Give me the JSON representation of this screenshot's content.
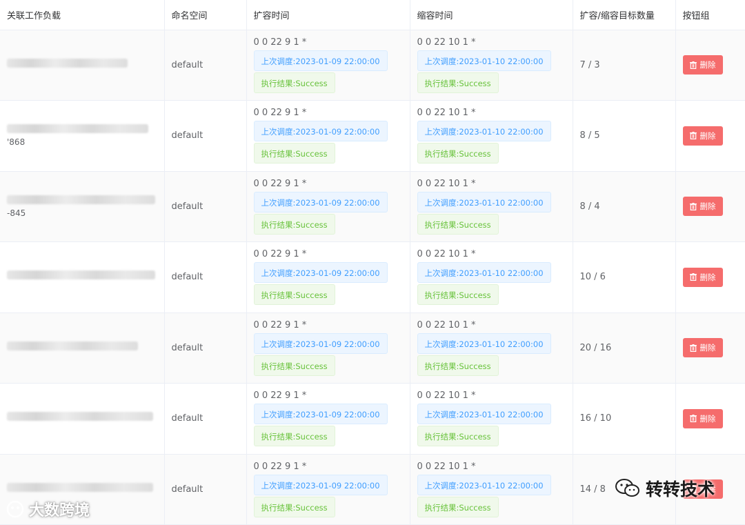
{
  "table": {
    "headers": {
      "workload": "关联工作负载",
      "namespace": "命名空间",
      "scale_out_time": "扩容时间",
      "scale_in_time": "缩容时间",
      "target_count": "扩容/缩容目标数量",
      "buttons": "按钮组"
    },
    "rows": [
      {
        "workload_suffix": "",
        "namespace": "default",
        "scale_out_cron": "0 0 22 9 1 *",
        "scale_out_last": "上次调度:2023-01-09 22:00:00",
        "scale_out_result": "执行结果:Success",
        "scale_in_cron": "0 0 22 10 1 *",
        "scale_in_last": "上次调度:2023-01-10 22:00:00",
        "scale_in_result": "执行结果:Success",
        "target": "7 / 3",
        "delete_label": "删除"
      },
      {
        "workload_suffix": "'868",
        "namespace": "default",
        "scale_out_cron": "0 0 22 9 1 *",
        "scale_out_last": "上次调度:2023-01-09 22:00:00",
        "scale_out_result": "执行结果:Success",
        "scale_in_cron": "0 0 22 10 1 *",
        "scale_in_last": "上次调度:2023-01-10 22:00:00",
        "scale_in_result": "执行结果:Success",
        "target": "8 / 5",
        "delete_label": "删除"
      },
      {
        "workload_suffix": "-845",
        "namespace": "default",
        "scale_out_cron": "0 0 22 9 1 *",
        "scale_out_last": "上次调度:2023-01-09 22:00:00",
        "scale_out_result": "执行结果:Success",
        "scale_in_cron": "0 0 22 10 1 *",
        "scale_in_last": "上次调度:2023-01-10 22:00:00",
        "scale_in_result": "执行结果:Success",
        "target": "8 / 4",
        "delete_label": "删除"
      },
      {
        "workload_suffix": "",
        "namespace": "default",
        "scale_out_cron": "0 0 22 9 1 *",
        "scale_out_last": "上次调度:2023-01-09 22:00:00",
        "scale_out_result": "执行结果:Success",
        "scale_in_cron": "0 0 22 10 1 *",
        "scale_in_last": "上次调度:2023-01-10 22:00:00",
        "scale_in_result": "执行结果:Success",
        "target": "10 / 6",
        "delete_label": "删除"
      },
      {
        "workload_suffix": "",
        "namespace": "default",
        "scale_out_cron": "0 0 22 9 1 *",
        "scale_out_last": "上次调度:2023-01-09 22:00:00",
        "scale_out_result": "执行结果:Success",
        "scale_in_cron": "0 0 22 10 1 *",
        "scale_in_last": "上次调度:2023-01-10 22:00:00",
        "scale_in_result": "执行结果:Success",
        "target": "20 / 16",
        "delete_label": "删除"
      },
      {
        "workload_suffix": "",
        "namespace": "default",
        "scale_out_cron": "0 0 22 9 1 *",
        "scale_out_last": "上次调度:2023-01-09 22:00:00",
        "scale_out_result": "执行结果:Success",
        "scale_in_cron": "0 0 22 10 1 *",
        "scale_in_last": "上次调度:2023-01-10 22:00:00",
        "scale_in_result": "执行结果:Success",
        "target": "16 / 10",
        "delete_label": "删除"
      },
      {
        "workload_suffix": "",
        "namespace": "default",
        "scale_out_cron": "0 0 22 9 1 *",
        "scale_out_last": "上次调度:2023-01-09 22:00:00",
        "scale_out_result": "执行结果:Success",
        "scale_in_cron": "0 0 22 10 1 *",
        "scale_in_last": "上次调度:2023-01-10 22:00:00",
        "scale_in_result": "执行结果:Success",
        "target": "14 / 8",
        "delete_label": "删除"
      }
    ]
  },
  "watermarks": {
    "left": "大数跨境",
    "right": "转转技术"
  },
  "colors": {
    "info_tag_text": "#409eff",
    "success_tag_text": "#67c23a",
    "danger_button": "#f56c6c",
    "stripe_row": "#fafafa"
  },
  "icons": {
    "delete": "trash-icon",
    "watermark_left": "logo-icon",
    "watermark_right": "wechat-icon"
  }
}
